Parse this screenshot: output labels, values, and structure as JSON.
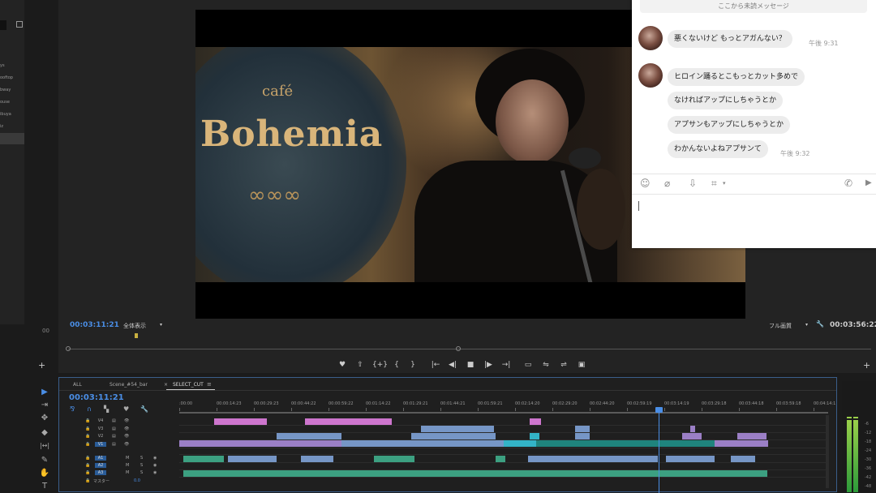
{
  "project_panel": {
    "items": [
      "ys",
      "ooftop",
      "bway",
      "ouse",
      "ibuya",
      "iz"
    ]
  },
  "video": {
    "sign_small": "café",
    "sign_large": "Bohemia",
    "sign_ornament": "∞∞∞"
  },
  "chat": {
    "unread_banner": "ここから未読メッセージ",
    "messages": [
      {
        "text": "悪くないけど もっとアガんない？",
        "time": "午後 9:31"
      },
      {
        "text": "ヒロイン踊るとこもっとカット多めで",
        "time": ""
      },
      {
        "text": "なければアップにしちゃうとか",
        "time": ""
      },
      {
        "text": "アプサンもアップにしちゃうとか",
        "time": ""
      },
      {
        "text": "わかんないよねアプサンて",
        "time": "午後 9:32"
      }
    ],
    "tools": {
      "emoji": "☺",
      "attach": "⌀",
      "download": "⇩",
      "crop": "⌗",
      "crop_caret": "▾",
      "call": "✆",
      "video": "▶"
    }
  },
  "monitor": {
    "timecode_current": "00:03:11:21",
    "zoom_select": "全体表示",
    "quality_select": "フル画質",
    "timecode_duration": "00:03:56:22",
    "side_label": "00",
    "add_left": "+",
    "add_right": "+",
    "wrench": "🔧",
    "controls": [
      "♥",
      "⇧",
      "{+}",
      "{",
      "}",
      "|←",
      "◀|",
      "■",
      "|▶",
      "→|",
      "▭",
      "⇋",
      "⇌",
      "▣"
    ]
  },
  "timeline": {
    "tabs": [
      "ALL",
      "Scene_#54_bar",
      "SELECT_CUT"
    ],
    "tab_close": "×",
    "tab_menu": "≡",
    "timecode": "00:03:11:21",
    "ticks": [
      ":00:00",
      "00:00:14:23",
      "00:00:29:23",
      "00:00:44:22",
      "00:00:59:22",
      "00:01:14:22",
      "00:01:29:21",
      "00:01:44:21",
      "00:01:59:21",
      "00:02:14:20",
      "00:02:29:20",
      "00:02:44:20",
      "00:02:59:19",
      "00:03:14:19",
      "00:03:29:18",
      "00:03:44:18",
      "00:03:59:18",
      "00:04:14:1"
    ],
    "video_tracks": [
      "V4",
      "V3",
      "V2",
      "V1"
    ],
    "audio_tracks": [
      "A1",
      "A2",
      "A3"
    ],
    "master_label": "マスター",
    "master_value": "0.0",
    "track_m": "M",
    "track_s": "S",
    "lock_icon": "🔒",
    "eye_icon": "👁",
    "film_icon": "▤"
  },
  "tools_panel": [
    "▶",
    "⇥",
    "✥",
    "◆",
    "|↔|",
    "✎",
    "✋",
    "T"
  ],
  "meter_labels": [
    "-6",
    "-12",
    "-18",
    "-24",
    "-30",
    "-36",
    "-42",
    "-48"
  ],
  "colors": {
    "timecode_blue": "#4a8ee6",
    "clip_pink": "#e07ee0",
    "clip_blue": "#7fa3d8",
    "clip_cyan": "#35c3d8",
    "clip_teal": "#1f8f87",
    "clip_purple": "#a88ad8",
    "audio_green": "#3fae8c"
  }
}
